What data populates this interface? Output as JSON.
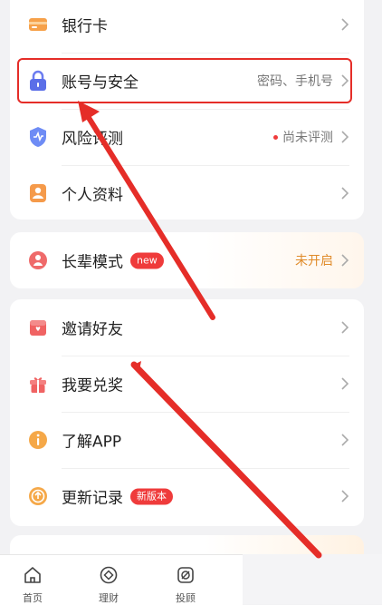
{
  "colors": {
    "accent_red": "#e52d28",
    "value_orange": "#e08b2a",
    "badge_red": "#ef3b3b"
  },
  "section1": {
    "items": [
      {
        "label": "银行卡",
        "icon": "bank-card-icon",
        "value": ""
      },
      {
        "label": "账号与安全",
        "icon": "lock-icon",
        "value": "密码、手机号"
      },
      {
        "label": "风险评测",
        "icon": "shield-check-icon",
        "value": "尚未评测"
      },
      {
        "label": "个人资料",
        "icon": "user-profile-icon",
        "value": ""
      }
    ]
  },
  "elder_mode": {
    "label": "长辈模式",
    "badge": "new",
    "icon": "elder-icon",
    "value": "未开启"
  },
  "section3": {
    "items": [
      {
        "label": "邀请好友",
        "icon": "invite-gift-icon",
        "value": ""
      },
      {
        "label": "我要兑奖",
        "icon": "prize-gift-icon",
        "value": ""
      },
      {
        "label": "了解APP",
        "icon": "info-icon",
        "value": ""
      },
      {
        "label": "更新记录",
        "icon": "update-icon",
        "value": "",
        "badge": "新版本"
      }
    ]
  },
  "tabbar": {
    "tabs": [
      {
        "label": "首页",
        "icon": "home-icon"
      },
      {
        "label": "理财",
        "icon": "finance-icon"
      },
      {
        "label": "投顾",
        "icon": "advisor-icon"
      }
    ]
  }
}
